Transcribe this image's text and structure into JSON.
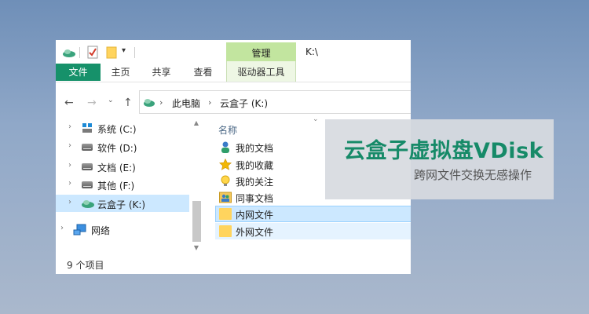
{
  "ribbon": {
    "manage_label": "管理",
    "path_title": "K:\\",
    "tabs": {
      "file": "文件",
      "home": "主页",
      "share": "共享",
      "view": "查看",
      "drive_tools": "驱动器工具"
    }
  },
  "address": {
    "this_pc": "此电脑",
    "current": "云盒子 (K:)"
  },
  "nav": {
    "items": [
      {
        "label": "系统 (C:)"
      },
      {
        "label": "软件 (D:)"
      },
      {
        "label": "文档 (E:)"
      },
      {
        "label": "其他 (F:)"
      },
      {
        "label": "云盒子 (K:)",
        "selected": true
      },
      {
        "label": "网络"
      }
    ]
  },
  "content": {
    "column_name": "名称",
    "files": [
      {
        "name": "我的文档"
      },
      {
        "name": "我的收藏"
      },
      {
        "name": "我的关注"
      },
      {
        "name": "同事文档"
      },
      {
        "name": "内网文件",
        "selected": true
      },
      {
        "name": "外网文件"
      }
    ]
  },
  "status": {
    "item_count": "9 个项目"
  },
  "banner": {
    "title": "云盒子虚拟盘VDisk",
    "subtitle": "跨网文件交换无感操作"
  },
  "colors": {
    "accent": "#16916a",
    "manage_tab": "#c2e59f",
    "selection": "#cce8ff",
    "banner_title": "#168a68"
  }
}
